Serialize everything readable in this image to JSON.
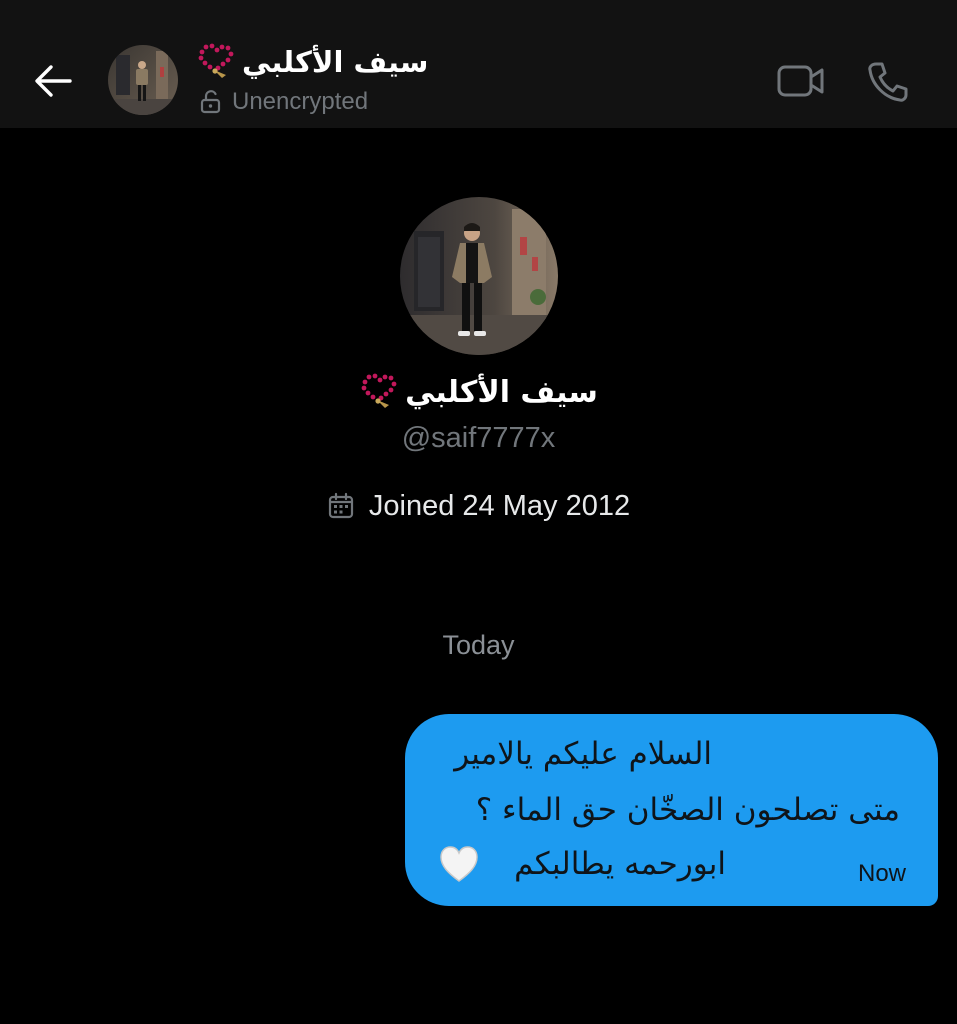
{
  "header": {
    "back_icon": "arrow-left-icon",
    "name": "سيف الأكلبي",
    "name_emoji": "prayer-beads-icon",
    "status_icon": "unlocked-padlock-icon",
    "status": "Unencrypted",
    "video_icon": "video-camera-icon",
    "phone_icon": "phone-icon"
  },
  "profile": {
    "name": "سيف الأكلبي",
    "handle": "@saif7777x",
    "joined_icon": "calendar-icon",
    "joined": "Joined 24 May 2012"
  },
  "conversation": {
    "date_label": "Today",
    "messages": [
      {
        "direction": "outgoing",
        "lines": [
          "السلام عليكم يالامير",
          "متى تصلحون الصخّان حق الماء ؟",
          "ابورحمه يطالبكم"
        ],
        "emoji": "white-heart-icon",
        "time": "Now"
      }
    ]
  },
  "colors": {
    "background": "#000000",
    "header_bg": "#121212",
    "bubble": "#1d9bf0",
    "muted_text": "#71767b",
    "primary_text": "#e7e9ea"
  }
}
